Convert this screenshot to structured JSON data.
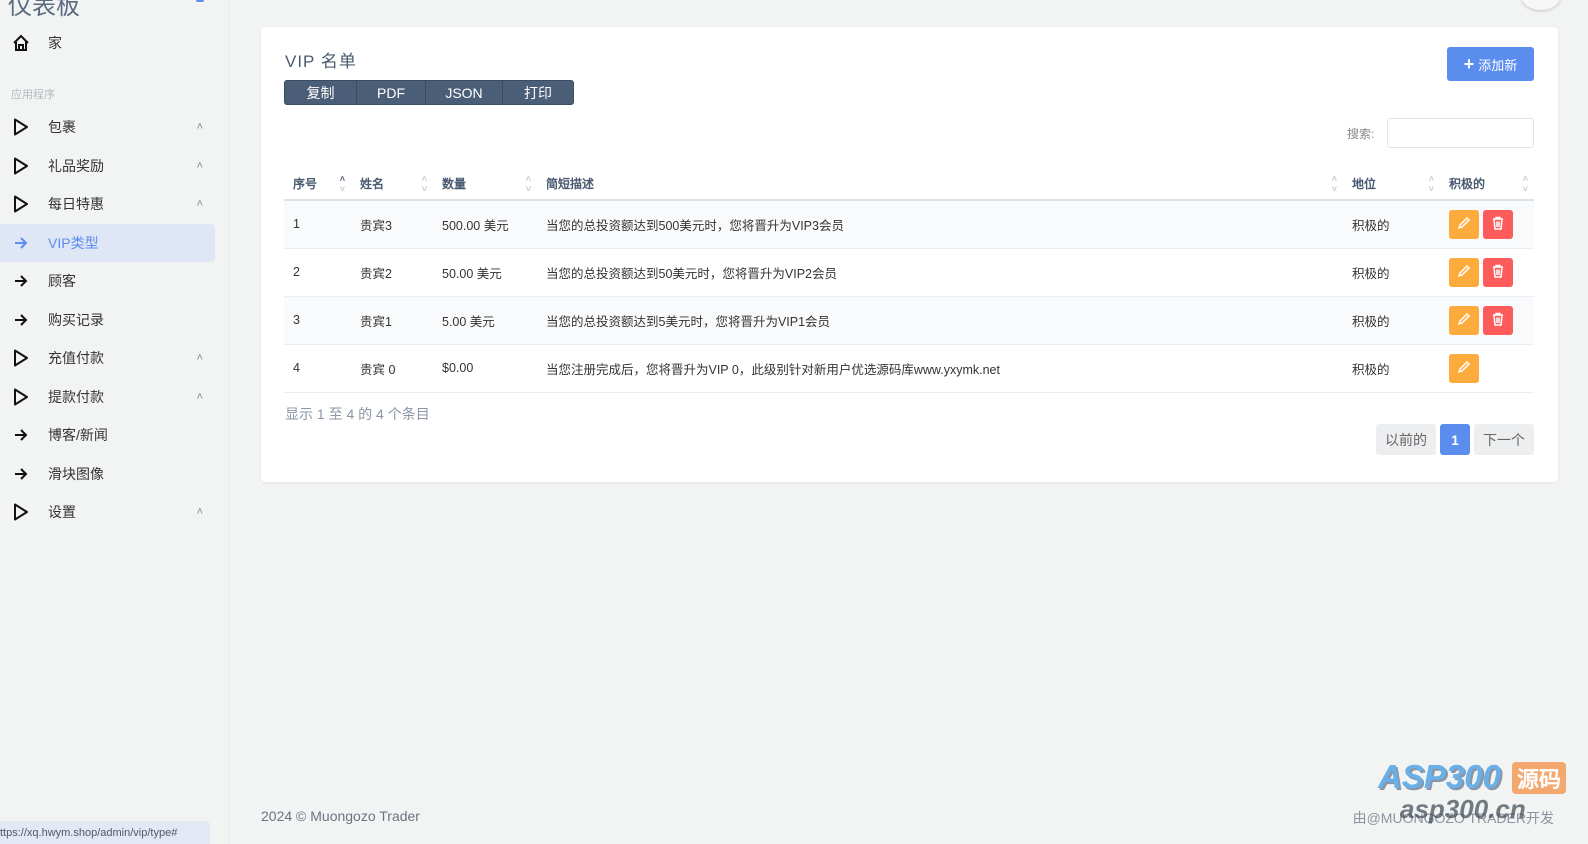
{
  "sidebar": {
    "brand": "仪表板",
    "home": "家",
    "section_label": "应用程序",
    "items": [
      {
        "label": "包裹",
        "icon": "play-icon",
        "expandable": true
      },
      {
        "label": "礼品奖励",
        "icon": "play-icon",
        "expandable": true
      },
      {
        "label": "每日特惠",
        "icon": "play-icon",
        "expandable": true
      },
      {
        "label": "VIP类型",
        "icon": "arrow-right-icon",
        "expandable": false,
        "active": true
      },
      {
        "label": "顾客",
        "icon": "arrow-right-icon",
        "expandable": false
      },
      {
        "label": "购买记录",
        "icon": "arrow-right-icon",
        "expandable": false
      },
      {
        "label": "充值付款",
        "icon": "play-icon",
        "expandable": true
      },
      {
        "label": "提款付款",
        "icon": "play-icon",
        "expandable": true
      },
      {
        "label": "博客/新闻",
        "icon": "arrow-right-icon",
        "expandable": false
      },
      {
        "label": "滑块图像",
        "icon": "arrow-right-icon",
        "expandable": false
      },
      {
        "label": "设置",
        "icon": "play-icon",
        "expandable": true
      }
    ]
  },
  "card": {
    "title": "VIP 名单",
    "export_buttons": [
      "复制",
      "PDF",
      "JSON",
      "打印"
    ],
    "add_button": "添加新",
    "search_label": "搜索:",
    "search_value": "",
    "columns": [
      "序号",
      "姓名",
      "数量",
      "简短描述",
      "地位",
      "积极的"
    ],
    "rows": [
      {
        "no": "1",
        "name": "贵宾3",
        "amount": "500.00 美元",
        "desc": "当您的总投资额达到500美元时，您将晋升为VIP3会员",
        "status": "积极的",
        "delete": true
      },
      {
        "no": "2",
        "name": "贵宾2",
        "amount": "50.00 美元",
        "desc": "当您的总投资额达到50美元时，您将晋升为VIP2会员",
        "status": "积极的",
        "delete": true
      },
      {
        "no": "3",
        "name": "贵宾1",
        "amount": "5.00 美元",
        "desc": "当您的总投资额达到5美元时，您将晋升为VIP1会员",
        "status": "积极的",
        "delete": true
      },
      {
        "no": "4",
        "name": "贵宾 0",
        "amount": "$0.00",
        "desc": "当您注册完成后，您将晋升为VIP 0，此级别针对新用户优选源码库www.yxymk.net",
        "status": "积极的",
        "delete": false
      }
    ],
    "info": "显示 1 至 4 的 4 个条目",
    "pagination": {
      "prev": "以前的",
      "current": "1",
      "next": "下一个"
    }
  },
  "footer": {
    "copyright": "2024 © Muongozo Trader",
    "credit": "由@MUONGOZO TRADER开发"
  },
  "status_url": "ttps://xq.hwym.shop/admin/vip/type#",
  "watermark": {
    "logo": "ASP300",
    "badge": "源码",
    "domain": "asp300.cn"
  },
  "colors": {
    "primary": "#5b8def",
    "edit": "#fdab3d",
    "delete": "#fe5c5c",
    "export": "#4b5e78"
  }
}
